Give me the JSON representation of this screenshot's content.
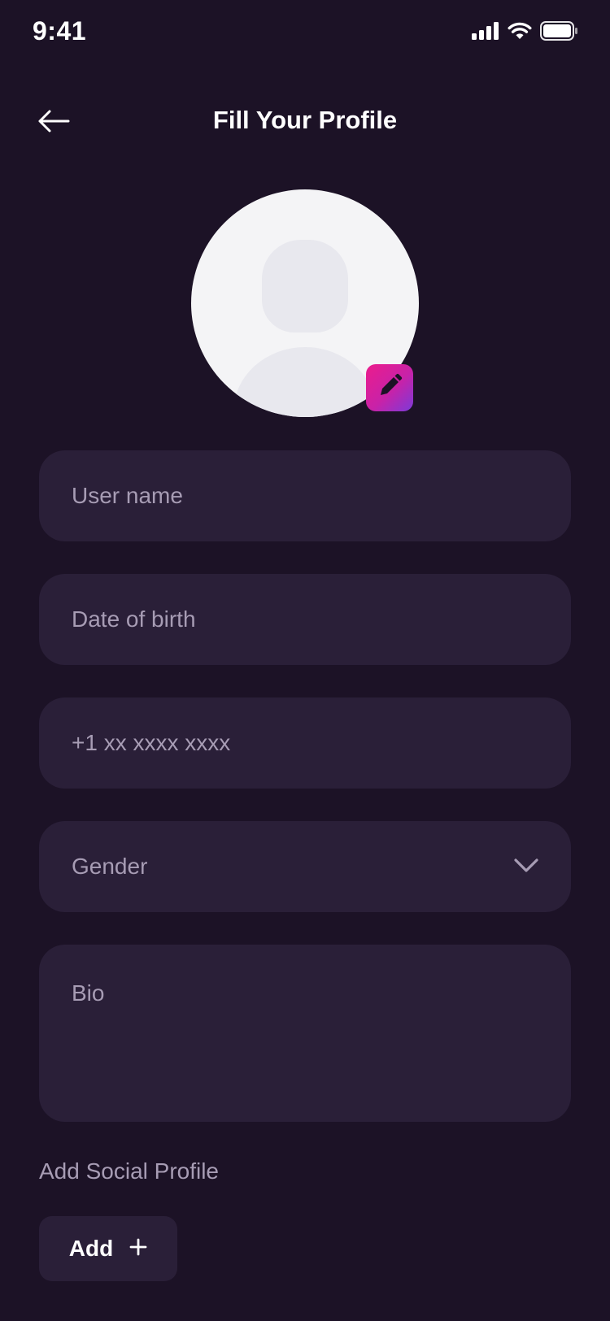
{
  "status_bar": {
    "time": "9:41",
    "icons": [
      "cellular-signal-icon",
      "wifi-icon",
      "battery-icon"
    ]
  },
  "header": {
    "title": "Fill Your Profile",
    "back_icon": "arrow-left-icon"
  },
  "avatar": {
    "edit_icon": "pencil-icon"
  },
  "form": {
    "username_placeholder": "User name",
    "dob_placeholder": "Date of birth",
    "phone_placeholder": "+1 xx xxxx xxxx",
    "gender_placeholder": "Gender",
    "bio_placeholder": "Bio"
  },
  "social": {
    "label": "Add Social Profile",
    "add_button_label": "Add"
  },
  "colors": {
    "background": "#1c1226",
    "field_background": "#2a1f38",
    "placeholder_text": "#a79cb4",
    "accent_gradient_start": "#ec1c8c",
    "accent_gradient_end": "#7c3ad8"
  }
}
